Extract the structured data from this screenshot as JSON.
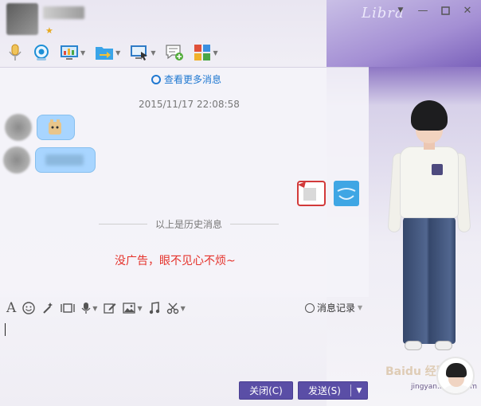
{
  "window": {
    "minimize_icon": "minimize-icon",
    "maximize_icon": "maximize-icon",
    "close_icon": "close-icon",
    "dropdown_icon": "chevron-down-icon"
  },
  "skin": {
    "constellation_label": "Libra",
    "watermark": "Baidu 经验",
    "watermark_url": "jingyan.baidu.com"
  },
  "toolbar": {
    "items": [
      {
        "icon": "microphone-icon",
        "color": "#e0a63b"
      },
      {
        "icon": "webcam-icon",
        "color": "#1d8fd6"
      },
      {
        "icon": "screen-share-icon",
        "color": "#2b84cf"
      },
      {
        "icon": "file-transfer-icon",
        "color": "#3aa4e8"
      },
      {
        "icon": "remote-desktop-icon",
        "color": "#2f7bc6"
      },
      {
        "icon": "create-discussion-icon",
        "color": "#54ad3c"
      },
      {
        "icon": "apps-grid-icon",
        "color": "#e0513a"
      }
    ]
  },
  "chat": {
    "more_messages": "查看更多消息",
    "timestamp": "2015/11/17 22:08:58",
    "history_divider": "以上是历史消息",
    "notice": "没广告，眼不见心不烦~"
  },
  "input_toolbar": {
    "items": [
      "font-icon",
      "emoji-icon",
      "magic-wand-icon",
      "screenshot-icon",
      "voice-message-icon",
      "edit-icon",
      "image-icon",
      "music-icon",
      "scissors-icon"
    ],
    "font_glyph": "A",
    "history_label": "消息记录"
  },
  "buttons": {
    "close": "关闭(C)",
    "send": "发送(S)"
  }
}
